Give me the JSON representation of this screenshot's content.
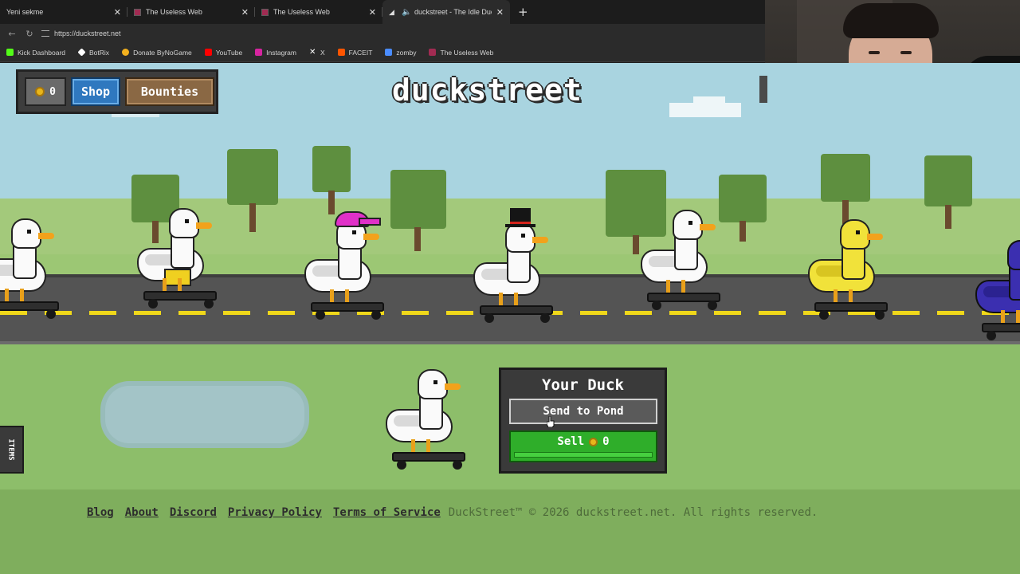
{
  "browser": {
    "tabs": [
      {
        "title": "Yeni sekme",
        "active": false
      },
      {
        "title": "The Useless Web",
        "active": false
      },
      {
        "title": "The Useless Web",
        "active": false
      },
      {
        "title": "duckstreet - The Idle Duck Co",
        "active": true
      }
    ],
    "url": "https://duckstreet.net",
    "bookmarks": [
      {
        "label": "Kick Dashboard",
        "icon": "kick-icon",
        "color": "#53fc18"
      },
      {
        "label": "BotRix",
        "icon": "botrix-icon",
        "color": "#ffffff"
      },
      {
        "label": "Donate ByNoGame",
        "icon": "bynogame-icon",
        "color": "#f2b01e"
      },
      {
        "label": "YouTube",
        "icon": "youtube-icon",
        "color": "#ff0000"
      },
      {
        "label": "Instagram",
        "icon": "instagram-icon",
        "color": "#d6249f"
      },
      {
        "label": "X",
        "icon": "x-icon",
        "color": "#ffffff"
      },
      {
        "label": "FACEIT",
        "icon": "faceit-icon",
        "color": "#ff5500"
      },
      {
        "label": "zomby",
        "icon": "zomby-icon",
        "color": "#4a8cff"
      },
      {
        "label": "The Useless Web",
        "icon": "uselessweb-icon",
        "color": "#a12b52"
      }
    ]
  },
  "game": {
    "logo": "duckstreet",
    "hud": {
      "coins": "0",
      "shop_label": "Shop",
      "bounties_label": "Bounties"
    },
    "panel": {
      "title": "Your Duck",
      "send_label": "Send to Pond",
      "sell_label": "Sell",
      "sell_value": "0"
    },
    "items_tab": "ITEMS",
    "footer": {
      "links": [
        "Blog",
        "About",
        "Discord",
        "Privacy Policy",
        "Terms of Service"
      ],
      "copyright": "DuckStreet™ © 2026 duckstreet.net. All rights reserved."
    }
  },
  "colors": {
    "sky": "#a9d4e0",
    "grass": "#8dbe6a",
    "road": "#545454",
    "lane": "#f0d81a",
    "shop": "#2f78bf",
    "bounties": "#8a6844",
    "sell": "#2fae2a"
  }
}
